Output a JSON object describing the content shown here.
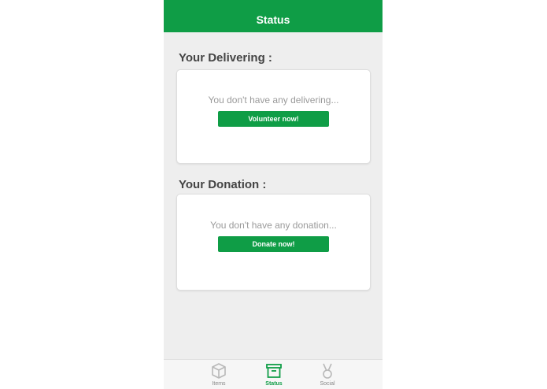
{
  "header": {
    "title": "Status"
  },
  "delivering": {
    "title": "Your Delivering :",
    "message": "You don't have any delivering...",
    "button_label": "Volunteer now!"
  },
  "donation": {
    "title": "Your Donation :",
    "message": "You don't have any donation...",
    "button_label": "Donate now!"
  },
  "tabbar": {
    "active": "Status",
    "accent_color": "#0f9d46",
    "tabs": [
      {
        "label": "Items",
        "icon": "box-icon"
      },
      {
        "label": "Status",
        "icon": "archive-icon"
      },
      {
        "label": "Social",
        "icon": "medal-icon"
      }
    ]
  }
}
